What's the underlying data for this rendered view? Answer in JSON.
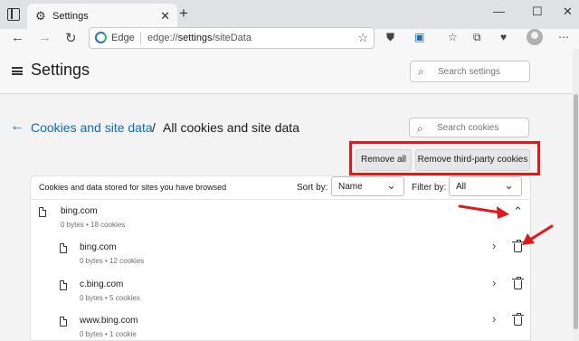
{
  "browser": {
    "tab_title": "Settings",
    "address_brand": "Edge",
    "url_prefix": "edge://",
    "url_strong": "settings",
    "url_suffix": "/siteData"
  },
  "header": {
    "title": "Settings",
    "search_placeholder": "Search settings"
  },
  "breadcrumb": {
    "parent": "Cookies and site data",
    "separator": "/",
    "current": "All cookies and site data",
    "search_placeholder": "Search cookies"
  },
  "actions": {
    "remove_all": "Remove all",
    "remove_third_party": "Remove third-party cookies"
  },
  "list": {
    "header_label": "Cookies and data stored for sites you have browsed",
    "sort_label": "Sort by:",
    "sort_value": "Name",
    "filter_label": "Filter by:",
    "filter_value": "All",
    "group": {
      "name": "bing.com",
      "meta": "0 bytes • 18 cookies"
    },
    "items": [
      {
        "name": "bing.com",
        "meta": "0 bytes • 12 cookies"
      },
      {
        "name": "c.bing.com",
        "meta": "0 bytes • 5 cookies"
      },
      {
        "name": "www.bing.com",
        "meta": "0 bytes • 1 cookie"
      }
    ]
  },
  "colors": {
    "accent": "#0f6cbd",
    "annotation_red": "#e0191c"
  }
}
